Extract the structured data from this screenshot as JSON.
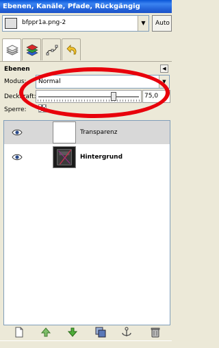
{
  "window": {
    "title": "Ebenen, Kanäle, Pfade, Rückgängig"
  },
  "image_selector": {
    "value": "bfppr1a.png-2",
    "auto_label": "Auto"
  },
  "tabs": [
    {
      "icon": "layers-icon",
      "active": true
    },
    {
      "icon": "channels-icon",
      "active": false
    },
    {
      "icon": "paths-icon",
      "active": false
    },
    {
      "icon": "undo-icon",
      "active": false
    }
  ],
  "panel": {
    "title": "Ebenen",
    "mode_label": "Modus:",
    "mode_value": "Normal",
    "opacity_label": "Deckkraft:",
    "opacity_value": "75,0",
    "opacity_fraction": 0.75,
    "lock_label": "Sperre:"
  },
  "layers": [
    {
      "name": "Transparenz",
      "visible": true,
      "selected": true,
      "bold": false
    },
    {
      "name": "Hintergrund",
      "visible": true,
      "selected": false,
      "bold": true
    }
  ],
  "toolbar": [
    "new-layer-icon",
    "raise-layer-icon",
    "lower-layer-icon",
    "duplicate-layer-icon",
    "anchor-layer-icon",
    "delete-layer-icon"
  ],
  "colors": {
    "annotation": "#e8000b",
    "titlebar": "#2363d9"
  }
}
